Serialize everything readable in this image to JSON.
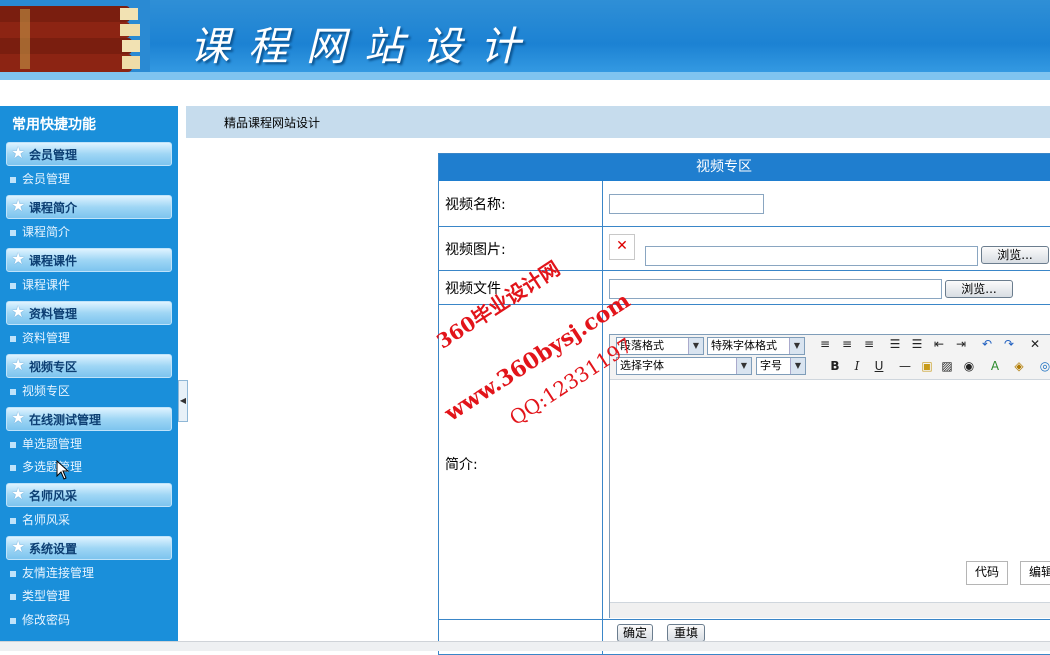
{
  "header": {
    "title": "课程网站设计"
  },
  "breadcrumb": "精品课程网站设计",
  "sidebar": {
    "title": "常用快捷功能",
    "groups": [
      {
        "label": "会员管理",
        "items": [
          "会员管理"
        ]
      },
      {
        "label": "课程简介",
        "items": [
          "课程简介"
        ]
      },
      {
        "label": "课程课件",
        "items": [
          "课程课件"
        ]
      },
      {
        "label": "资料管理",
        "items": [
          "资料管理"
        ]
      },
      {
        "label": "视频专区",
        "items": [
          "视频专区"
        ]
      },
      {
        "label": "在线测试管理",
        "items": [
          "单选题管理",
          "多选题管理"
        ]
      },
      {
        "label": "名师风采",
        "items": [
          "名师风采"
        ]
      },
      {
        "label": "系统设置",
        "items": [
          "友情连接管理",
          "类型管理",
          "修改密码"
        ]
      }
    ]
  },
  "form": {
    "title": "视频专区",
    "video_name_label": "视频名称:",
    "video_image_label": "视频图片:",
    "video_file_label": "视频文件",
    "intro_label": "简介:",
    "browse_label": "浏览...",
    "video_name_value": "",
    "submit_label": "确定",
    "reset_label": "重填"
  },
  "editor": {
    "paragraph_format": "段落格式",
    "special_font_format": "特殊字体格式",
    "font_select": "选择字体",
    "font_size": "字号",
    "tab_code": "代码",
    "tab_edit": "编辑"
  },
  "watermark": {
    "line1": "360毕业设计网",
    "line2": "www.360bysj.com",
    "line3": "QQ:12331197"
  },
  "colors": {
    "header_blue": "#1c82d3",
    "sidebar_blue": "#1a8fda",
    "table_border": "#3a86c8",
    "watermark_red": "#e2141a"
  }
}
